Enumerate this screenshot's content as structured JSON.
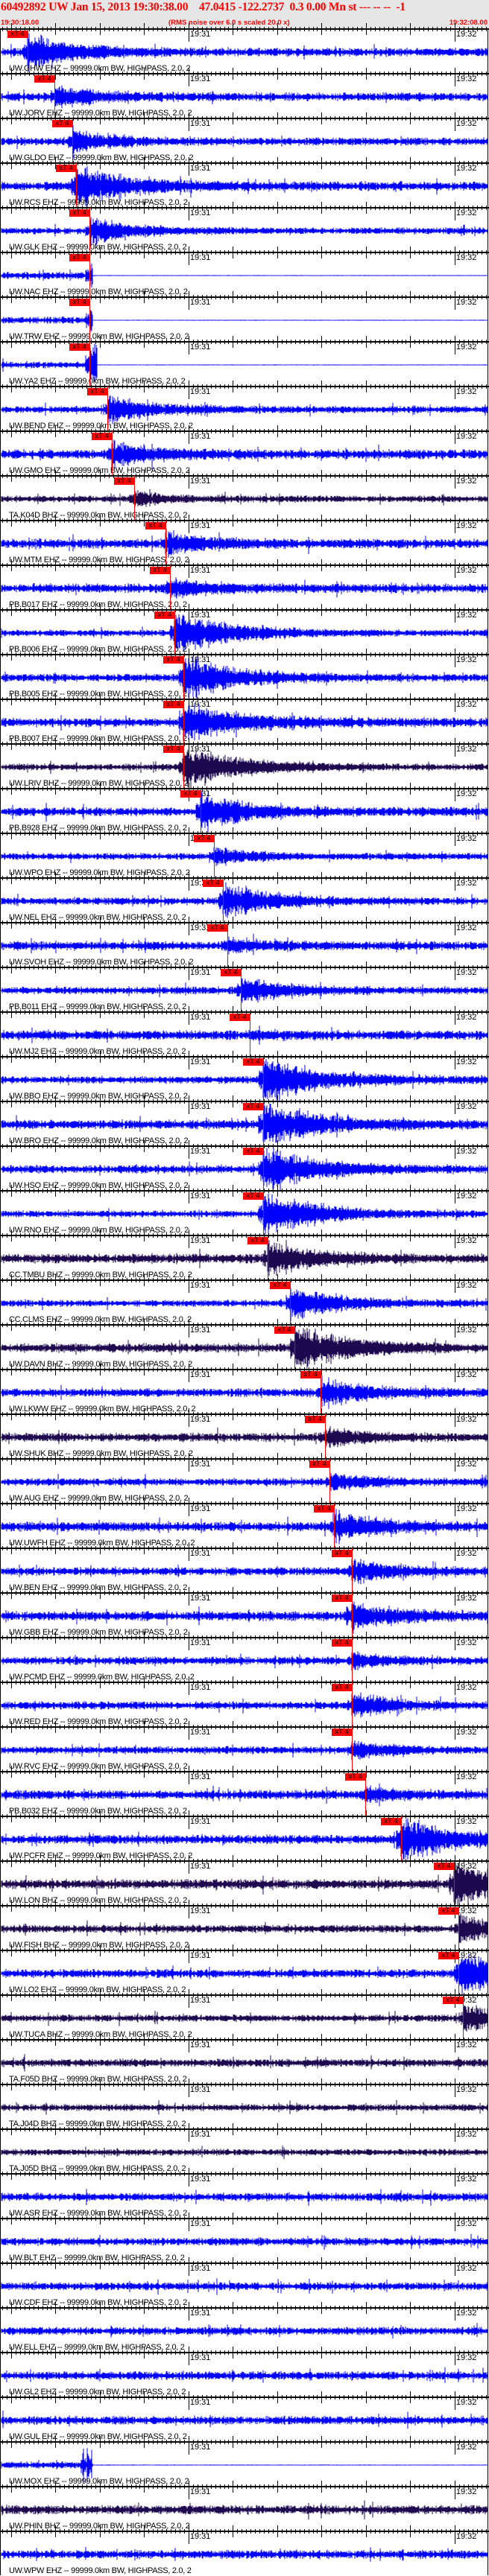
{
  "header": {
    "title": "60492892 UW Jan 15, 2013 19:30:38.00    47.0415 -122.2737  0.3 0.00 Mn st --- -- --  -1",
    "start_time": "19:30:18.00",
    "end_time": "19:32:08.00",
    "note": "(RMS noise over 6.0 s scaled 20.0 x)"
  },
  "time_axis": {
    "span_s": 110,
    "ticks": [
      {
        "label": "19:31",
        "t_s": 42
      },
      {
        "label": "19:32",
        "t_s": 102
      }
    ]
  },
  "pick_label": "xT 4",
  "colors": {
    "blue": "#0000ff",
    "purple": "#1e0850",
    "pick": "#ff0000"
  },
  "traces": [
    {
      "label": "UW.GHW EHZ -- 99999.0km BW, HIGHPASS, 2.0, 2",
      "color": "blue",
      "pick_s": 5.7,
      "event": 0.8
    },
    {
      "label": "UW.JORV EHZ -- 99999.0km BW, HIGHPASS, 2.0, 2",
      "color": "blue",
      "pick_s": 11.8,
      "event": 0.5
    },
    {
      "label": "UW.GLDO EHZ -- 99999.0km BW, HIGHPASS, 2.0, 2",
      "color": "blue",
      "pick_s": 15.8,
      "event": 0.5
    },
    {
      "label": "UW.RCS EHZ -- 99999.0km BW, HIGHPASS, 2.0, 2",
      "color": "blue",
      "pick_s": 16.6,
      "event": 0.9
    },
    {
      "label": "UW.GLK EHZ -- 99999.0km BW, HIGHPASS, 2.0, 2",
      "color": "blue",
      "pick_s": 19.7,
      "event": 0.6
    },
    {
      "label": "UW.NAC EHZ -- 99999.0km BW, HIGHPASS, 2.0, 2",
      "color": "blue",
      "pick_s": 19.7,
      "event": 0.6,
      "flat_after_s": 20.5
    },
    {
      "label": "UW.TRW EHZ -- 99999.0km BW, HIGHPASS, 2.0, 2",
      "color": "blue",
      "pick_s": 19.7,
      "event": 0.6,
      "flat_after_s": 20.5
    },
    {
      "label": "UW.YA2 EHZ -- 99999.0km BW, HIGHPASS, 2.0, 2",
      "color": "blue",
      "pick_s": 19.7,
      "event": 1.0,
      "flat_after_s": 21.5
    },
    {
      "label": "UW.BEND EHZ -- 99999.0km BW, HIGHPASS, 2.0, 2",
      "color": "blue",
      "pick_s": 23.7,
      "event": 0.6
    },
    {
      "label": "UW.GMO EHZ -- 99999.0km BW, HIGHPASS, 2.0, 2",
      "color": "blue",
      "pick_s": 24.7,
      "event": 0.5
    },
    {
      "label": "TA.K04D BHZ -- 99999.0km BW, HIGHPASS, 2.0, 2",
      "color": "purple",
      "pick_s": 29.7,
      "event": 0.3
    },
    {
      "label": "UW.MTM EHZ -- 99999.0km BW, HIGHPASS, 2.0, 2",
      "color": "blue",
      "pick_s": 36.8,
      "event": 0.5
    },
    {
      "label": "PB.B017 EHZ -- 99999.0km BW, HIGHPASS, 2.0, 2",
      "color": "blue",
      "pick_s": 37.8,
      "event": 0.4
    },
    {
      "label": "PB.B006 EHZ -- 99999.0km BW, HIGHPASS, 2.0, 2",
      "color": "blue",
      "pick_s": 38.8,
      "event": 1.0
    },
    {
      "label": "PB.B005 EHZ -- 99999.0km BW, HIGHPASS, 2.0, 2",
      "color": "blue",
      "pick_s": 40.8,
      "event": 1.0
    },
    {
      "label": "PB.B007 EHZ -- 99999.0km BW, HIGHPASS, 2.0, 2",
      "color": "blue",
      "pick_s": 40.8,
      "event": 0.9
    },
    {
      "label": "UW.LRIV BHZ -- 99999.0km BW, HIGHPASS, 2.0, 2",
      "color": "purple",
      "pick_s": 40.8,
      "event": 1.0
    },
    {
      "label": "PB.B928 EHZ -- 99999.0km BW, HIGHPASS, 2.0, 2",
      "color": "blue",
      "pick_s": 44.7,
      "event": 0.8
    },
    {
      "label": "UW.WPO EHZ -- 99999.0km BW, HIGHPASS, 2.0, 2",
      "color": "blue",
      "pick_s": 47.7,
      "event": 0.4
    },
    {
      "label": "UW.NEL EHZ -- 99999.0km BW, HIGHPASS, 2.0, 2",
      "color": "blue",
      "pick_s": 49.7,
      "event": 0.8
    },
    {
      "label": "UW.SVOH EHZ -- 99999.0km BW, HIGHPASS, 2.0, 2",
      "color": "blue",
      "pick_s": 50.8,
      "event": 0.3
    },
    {
      "label": "PB.B011 EHZ -- 99999.0km BW, HIGHPASS, 2.0, 2",
      "color": "blue",
      "pick_s": 53.8,
      "event": 0.6
    },
    {
      "label": "UW.MJ2 EHZ -- 99999.0km BW, HIGHPASS, 2.0, 2",
      "color": "blue",
      "pick_s": 55.8,
      "event": 0.15
    },
    {
      "label": "UW.BBO EHZ -- 99999.0km BW, HIGHPASS, 2.0, 2",
      "color": "blue",
      "pick_s": 58.8,
      "event": 1.0
    },
    {
      "label": "UW.BRO EHZ -- 99999.0km BW, HIGHPASS, 2.0, 2",
      "color": "blue",
      "pick_s": 58.8,
      "event": 1.0
    },
    {
      "label": "UW.HSO EHZ -- 99999.0km BW, HIGHPASS, 2.0, 2",
      "color": "blue",
      "pick_s": 58.8,
      "event": 1.0
    },
    {
      "label": "UW.RNO EHZ -- 99999.0km BW, HIGHPASS, 2.0, 2",
      "color": "blue",
      "pick_s": 58.8,
      "event": 1.0
    },
    {
      "label": "CC.TMBU BHZ -- 99999.0km BW, HIGHPASS, 2.0, 2",
      "color": "purple",
      "pick_s": 59.8,
      "event": 0.7
    },
    {
      "label": "CC.CLMS EHZ -- 99999.0km BW, HIGHPASS, 2.0, 2",
      "color": "blue",
      "pick_s": 64.9,
      "event": 0.8
    },
    {
      "label": "UW.DAVN BHZ -- 99999.0km BW, HIGHPASS, 2.0, 2",
      "color": "purple",
      "pick_s": 65.9,
      "event": 1.0
    },
    {
      "label": "UW.LKWW EHZ -- 99999.0km BW, HIGHPASS, 2.0, 2",
      "color": "blue",
      "pick_s": 71.8,
      "event": 0.6
    },
    {
      "label": "UW.SHUK BHZ -- 99999.0km BW, HIGHPASS, 2.0, 2",
      "color": "purple",
      "pick_s": 72.8,
      "event": 0.4
    },
    {
      "label": "UW.AUG EHZ -- 99999.0km BW, HIGHPASS, 2.0, 2",
      "color": "blue",
      "pick_s": 73.8,
      "event": 0.4
    },
    {
      "label": "UW.UWFH EHZ -- 99999.0km BW, HIGHPASS, 2.0, 2",
      "color": "blue",
      "pick_s": 74.8,
      "event": 0.6
    },
    {
      "label": "UW.BEN EHZ -- 99999.0km BW, HIGHPASS, 2.0, 2",
      "color": "blue",
      "pick_s": 78.8,
      "event": 0.5
    },
    {
      "label": "UW.GBB EHZ -- 99999.0km BW, HIGHPASS, 2.0, 2",
      "color": "blue",
      "pick_s": 78.8,
      "event": 0.6
    },
    {
      "label": "UW.PCMD EHZ -- 99999.0km BW, HIGHPASS, 2.0, 2",
      "color": "blue",
      "pick_s": 78.8,
      "event": 0.3
    },
    {
      "label": "UW.RED EHZ -- 99999.0km BW, HIGHPASS, 2.0, 2",
      "color": "blue",
      "pick_s": 78.8,
      "event": 0.5
    },
    {
      "label": "UW.RVC EHZ -- 99999.0km BW, HIGHPASS, 2.0, 2",
      "color": "blue",
      "pick_s": 78.8,
      "event": 0.4
    },
    {
      "label": "PB.B032 EHZ -- 99999.0km BW, HIGHPASS, 2.0, 2",
      "color": "blue",
      "pick_s": 81.8,
      "event": 0.3
    },
    {
      "label": "UW.PCFR EHZ -- 99999.0km BW, HIGHPASS, 2.0, 2",
      "color": "blue",
      "pick_s": 89.9,
      "event": 1.0
    },
    {
      "label": "UW.LON BHZ -- 99999.0km BW, HIGHPASS, 2.0, 2",
      "color": "purple",
      "pick_s": 101.8,
      "event": 1.0
    },
    {
      "label": "UW.FISH BHZ -- 99999.0km BW, HIGHPASS, 2.0, 2",
      "color": "purple",
      "pick_s": 102.9,
      "event": 0.6
    },
    {
      "label": "UW.LO2 EHZ -- 99999.0km BW, HIGHPASS, 2.0, 2",
      "color": "blue",
      "pick_s": 102.9,
      "event": 1.0
    },
    {
      "label": "UW.TUCA BHZ -- 99999.0km BW, HIGHPASS, 2.0, 2",
      "color": "purple",
      "pick_s": 103.9,
      "event": 0.6
    },
    {
      "label": "TA.F05D BHZ -- 99999.0km BW, HIGHPASS, 2.0, 2",
      "color": "purple",
      "event": 0
    },
    {
      "label": "TA.J04D BHZ -- 99999.0km BW, HIGHPASS, 2.0, 2",
      "color": "purple",
      "event": 0
    },
    {
      "label": "TA.J05D BHZ -- 99999.0km BW, HIGHPASS, 2.0, 2",
      "color": "purple",
      "event": 0
    },
    {
      "label": "UW.ASR EHZ -- 99999.0km BW, HIGHPASS, 2.0, 2",
      "color": "blue",
      "event": 0
    },
    {
      "label": "UW.BLT EHZ -- 99999.0km BW, HIGHPASS, 2.0, 2",
      "color": "blue",
      "event": 0
    },
    {
      "label": "UW.CDF EHZ -- 99999.0km BW, HIGHPASS, 2.0, 2",
      "color": "blue",
      "event": 0
    },
    {
      "label": "UW.ELL EHZ -- 99999.0km BW, HIGHPASS, 2.0, 2",
      "color": "blue",
      "event": 0
    },
    {
      "label": "UW.GL2 EHZ -- 99999.0km BW, HIGHPASS, 2.0, 2",
      "color": "blue",
      "event": 0
    },
    {
      "label": "UW.GUL EHZ -- 99999.0km BW, HIGHPASS, 2.0, 2",
      "color": "blue",
      "event": 0
    },
    {
      "label": "UW.MOX EHZ -- 99999.0km BW, HIGHPASS, 2.0, 2",
      "color": "blue",
      "event": 0.9,
      "spike_s": 19.0,
      "flat_after_s": 20.5
    },
    {
      "label": "UW.PHIN BHZ -- 99999.0km BW, HIGHPASS, 2.0, 2",
      "color": "purple",
      "event": 0
    },
    {
      "label": "UW.WPW EHZ -- 99999.0km BW, HIGHPASS, 2.0, 2",
      "color": "blue",
      "event": 0
    }
  ]
}
